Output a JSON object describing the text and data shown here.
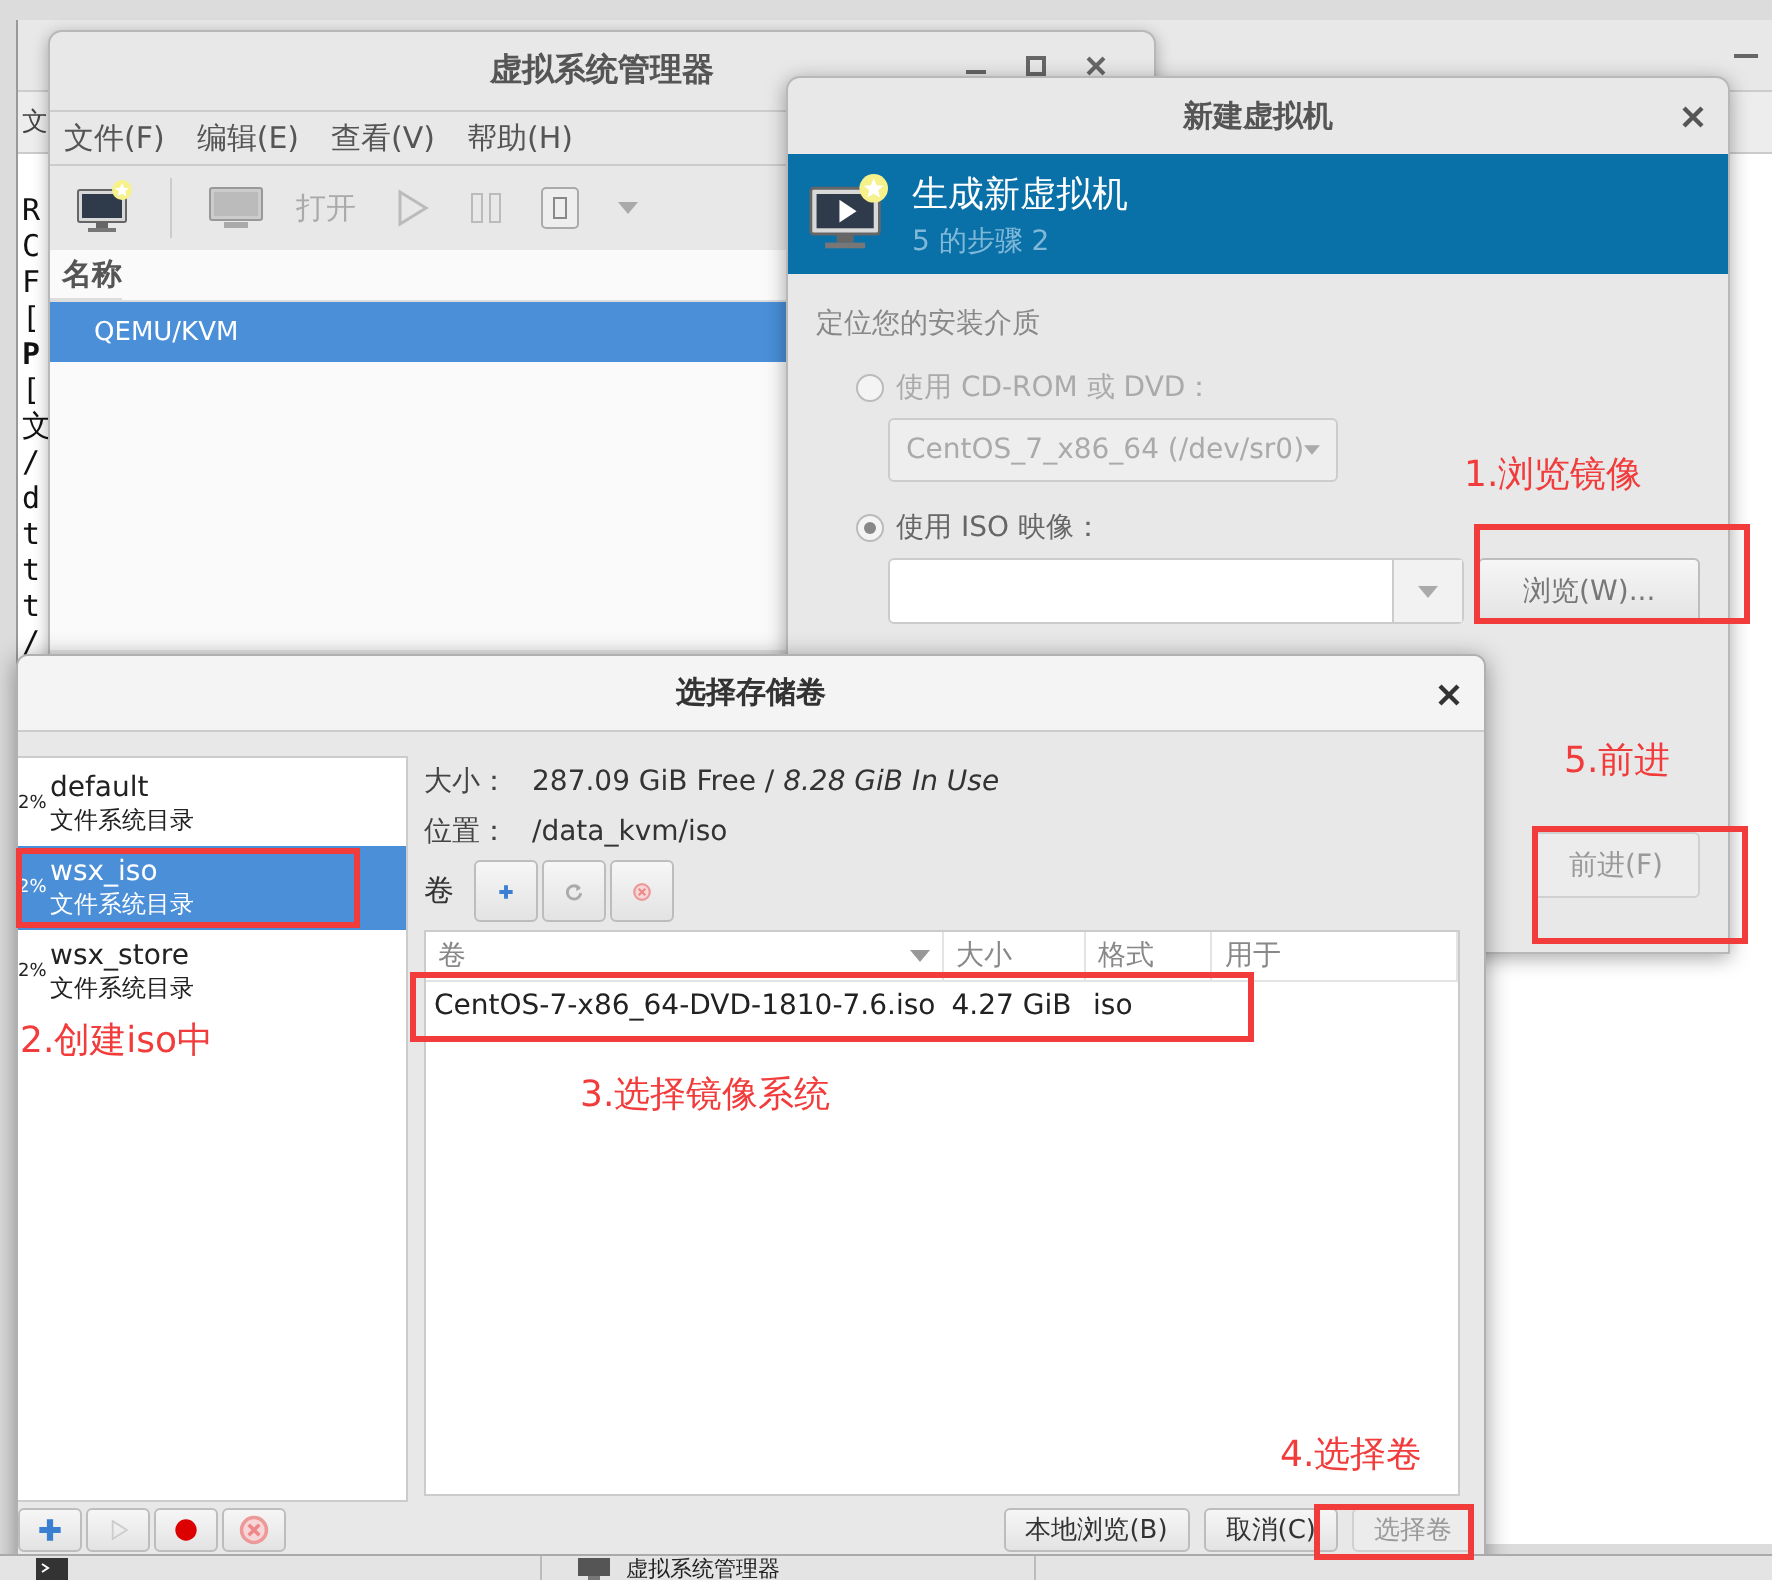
{
  "terminal": {
    "menu": [
      "文"
    ],
    "lines": [
      {
        "text": "R",
        "bold": false
      },
      {
        "text": "C",
        "bold": false
      },
      {
        "text": "F",
        "bold": false
      },
      {
        "text": "[",
        "bold": false
      },
      {
        "text": "P",
        "bold": true
      },
      {
        "text": "[",
        "bold": false
      },
      {
        "text": "文",
        "bold": false
      },
      {
        "text": "/",
        "bold": false
      },
      {
        "text": "d",
        "bold": false
      },
      {
        "text": "t",
        "bold": false
      },
      {
        "text": "t",
        "bold": false
      },
      {
        "text": "t",
        "bold": false
      },
      {
        "text": "/",
        "bold": false
      }
    ]
  },
  "manager": {
    "title": "虚拟系统管理器",
    "menu": [
      "文件(F)",
      "编辑(E)",
      "查看(V)",
      "帮助(H)"
    ],
    "open_label": "打开",
    "list": {
      "header": "名称",
      "rows": [
        {
          "label": "QEMU/KVM",
          "selected": true
        }
      ]
    }
  },
  "new_vm": {
    "title": "新建虚拟机",
    "banner": {
      "title": "生成新虚拟机",
      "subtitle": "5 的步骤 2"
    },
    "section_label": "定位您的安装介质",
    "options": [
      {
        "kind": "dropdown",
        "label": "使用 CD-ROM 或 DVD：",
        "selected": false,
        "disabled": true,
        "value": "CentOS_7_x86_64 (/dev/sr0)"
      },
      {
        "kind": "combo",
        "label": "使用 ISO 映像：",
        "selected": true,
        "disabled": false,
        "button": "浏览(W)..."
      }
    ],
    "forward_button": {
      "label": "前进(F)",
      "disabled": true
    }
  },
  "storage": {
    "title": "选择存储卷",
    "pools": [
      {
        "usage": "2%",
        "name": "default",
        "type": "文件系统目录",
        "selected": false
      },
      {
        "usage": "2%",
        "name": "wsx_iso",
        "type": "文件系统目录",
        "selected": true
      },
      {
        "usage": "2%",
        "name": "wsx_store",
        "type": "文件系统目录",
        "selected": false
      }
    ],
    "size_label": "大小：",
    "size_value": "287.09 GiB Free / *8.28 GiB In Use*",
    "location_label": "位置：",
    "location_value": "/data_kvm/iso",
    "volumes_label": "卷",
    "table": {
      "columns": [
        "卷",
        "大小",
        "格式",
        "用于"
      ],
      "rows": [
        {
          "cells": [
            "CentOS-7-x86_64-DVD-1810-7.6.iso",
            "4.27 GiB",
            "iso"
          ],
          "selected": false
        }
      ]
    },
    "buttons": [
      {
        "label": "本地浏览(B)",
        "disabled": false
      },
      {
        "label": "取消(C)",
        "disabled": false
      },
      {
        "label": "选择卷",
        "disabled": true
      }
    ]
  },
  "taskbar": {
    "items": [
      {
        "kind": "terminal"
      },
      {
        "kind": "manager",
        "label": "虚拟系统管理器"
      }
    ]
  },
  "annotations": [
    {
      "text": "1.浏览镜像"
    },
    {
      "text": "2.创建iso中"
    },
    {
      "text": "3.选择镜像系统"
    },
    {
      "text": "4.选择卷"
    },
    {
      "text": "5.前进"
    }
  ]
}
